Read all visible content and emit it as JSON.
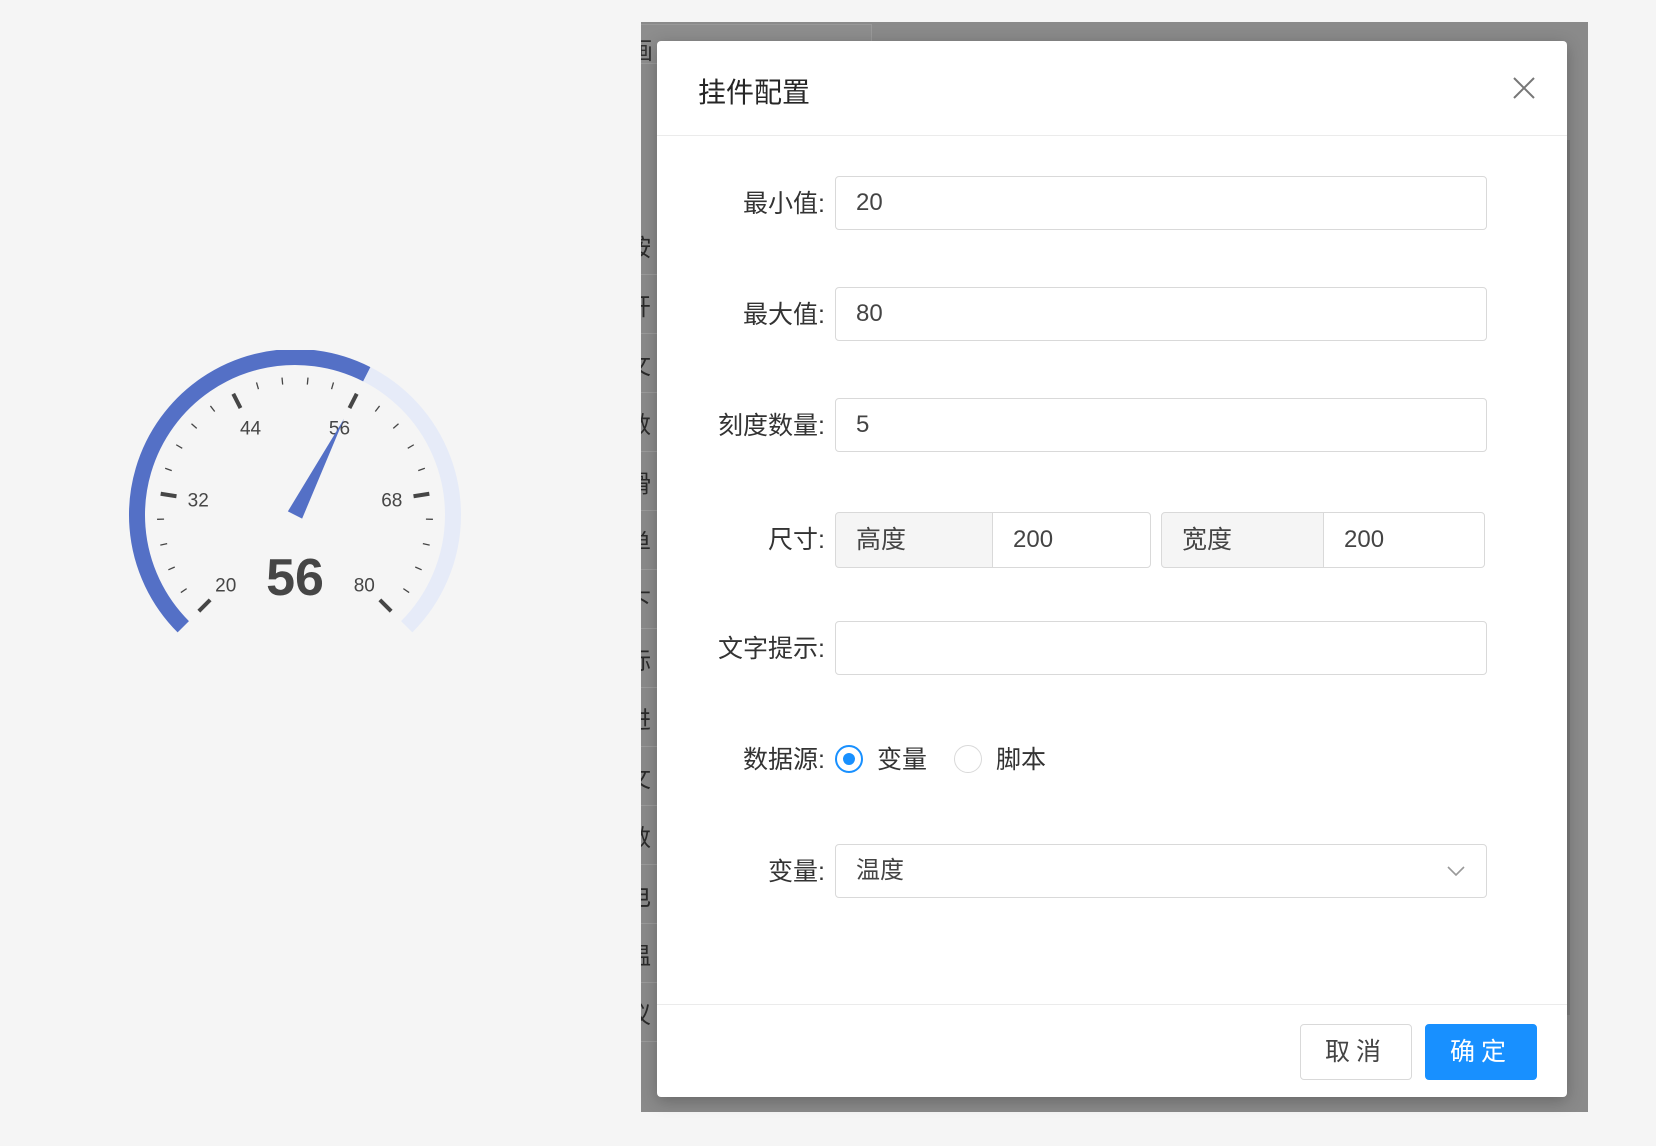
{
  "gauge": {
    "value": 56,
    "display_value": "56",
    "min": 20,
    "max": 80,
    "major_labels": [
      "20",
      "32",
      "44",
      "56",
      "68",
      "80"
    ],
    "colors": {
      "fill": "#5470c6",
      "track": "#e6ebf8",
      "ticks": "#464646",
      "text": "#464646"
    }
  },
  "background_editor": {
    "tab_label": "画",
    "list_items": [
      "按",
      "开",
      "文",
      "数",
      "滑",
      "单",
      "下",
      "标",
      "进",
      "文",
      "数",
      "电",
      "温",
      "仪"
    ]
  },
  "modal": {
    "title": "挂件配置",
    "fields": {
      "min": {
        "label": "最小值:",
        "value": "20"
      },
      "max": {
        "label": "最大值:",
        "value": "80"
      },
      "tick_count": {
        "label": "刻度数量:",
        "value": "5"
      },
      "size": {
        "label": "尺寸:",
        "height_label": "高度",
        "height_value": "200",
        "width_label": "宽度",
        "width_value": "200"
      },
      "hint_text": {
        "label": "文字提示:",
        "value": ""
      },
      "data_source": {
        "label": "数据源:",
        "options": [
          "变量",
          "脚本"
        ],
        "selected": "变量"
      },
      "variable": {
        "label": "变量:",
        "value": "温度"
      }
    },
    "buttons": {
      "cancel": "取消",
      "ok": "确定"
    }
  },
  "colors": {
    "primary": "#1890ff",
    "overlay": "#8a8a8a"
  }
}
